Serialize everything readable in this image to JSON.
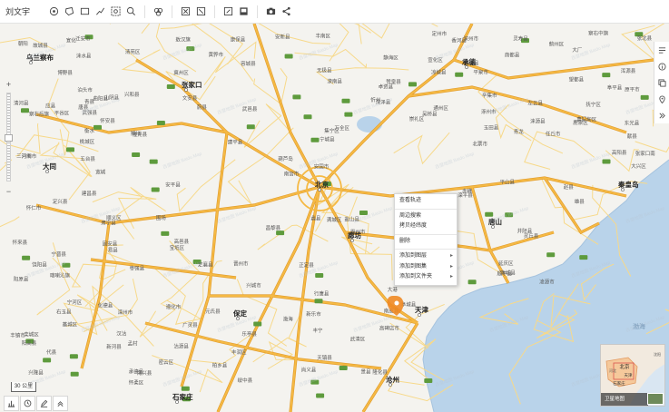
{
  "app": {
    "title": "刘文宇"
  },
  "toolbar": {
    "icons": [
      "locate-icon",
      "polygon-icon",
      "rectangle-icon",
      "polyline-icon",
      "zoom-box-icon",
      "zoom-search-icon",
      "layers-icon",
      "frame-icon",
      "frame-expand-icon",
      "fullscreen-icon",
      "display-icon",
      "camera-icon",
      "share-icon"
    ]
  },
  "map": {
    "cities": [
      {
        "name": "北京"
      },
      {
        "name": "廊坊"
      },
      {
        "name": "保定"
      },
      {
        "name": "天津"
      },
      {
        "name": "张家口"
      },
      {
        "name": "大同"
      },
      {
        "name": "承德"
      },
      {
        "name": "秦皇岛"
      },
      {
        "name": "唐山"
      },
      {
        "name": "沧州"
      },
      {
        "name": "乌兰察布"
      },
      {
        "name": "石家庄"
      }
    ],
    "labels": [
      "化德县",
      "康保县",
      "沽源县",
      "丰宁",
      "隆化县",
      "围场",
      "张北县",
      "尚义县",
      "宣化区",
      "怀来县",
      "延庆区",
      "怀柔区",
      "密云区",
      "平谷区",
      "顺义区",
      "三河市",
      "香河县",
      "大厂",
      "通州区",
      "大兴区",
      "武清区",
      "宝坻区",
      "蓟州区",
      "兴隆县",
      "遵化市",
      "迁安市",
      "滦州市",
      "丰润区",
      "玉田县",
      "宁河区",
      "涿州市",
      "固安县",
      "霸州市",
      "雄县",
      "容城县",
      "安新县",
      "高碑店市",
      "定兴县",
      "易县",
      "涞水县",
      "涞源县",
      "阜平县",
      "蔚县",
      "阳原县",
      "广灵县",
      "灵丘县",
      "浑源县",
      "天镇县",
      "阳高县",
      "怀安县",
      "万全区",
      "崇礼区",
      "赤城县",
      "平泉市",
      "宽城",
      "青龙",
      "抚宁区",
      "昌黎县",
      "乐亭县",
      "滦南县",
      "曹妃甸区",
      "丰南区",
      "汉沽",
      "大港",
      "静海区",
      "文安县",
      "任丘市",
      "河间市",
      "肃宁县",
      "献县",
      "泊头市",
      "青县",
      "黄骅市",
      "孟村",
      "盐山县",
      "海兴县",
      "南皮县",
      "东光县",
      "吴桥县",
      "高阳县",
      "蠡县",
      "博野县",
      "清苑区",
      "望都县",
      "唐县",
      "顺平县",
      "满城区",
      "曲阳县",
      "定州市",
      "安国市",
      "深泽县",
      "无极县",
      "新乐市",
      "行唐县",
      "灵寿县",
      "平山县",
      "井陉县",
      "鹿泉区",
      "正定县",
      "藁城区",
      "晋州市",
      "辛集市",
      "深州市",
      "饶阳县",
      "武强县",
      "衡水",
      "阜城县",
      "景县",
      "枣强县",
      "冀州区",
      "桃城区",
      "宁晋县",
      "赵县",
      "栾城区",
      "元氏县",
      "赞皇县",
      "高邑县",
      "柏乡县",
      "隆尧县",
      "新河县",
      "南宫市",
      "清河县",
      "故城县",
      "武邑县",
      "安平县",
      "定襄县",
      "五台县",
      "繁峙县",
      "代县",
      "原平市",
      "忻州",
      "应县",
      "山阴县",
      "朔州",
      "怀仁市",
      "左云县",
      "右玉县",
      "凉城县",
      "丰镇市",
      "兴和县",
      "商都县",
      "察右后旗",
      "察右中旗",
      "卓资县",
      "集宁区",
      "承德县",
      "滦平县",
      "北票市",
      "建平县",
      "宁城县",
      "喀喇沁旗",
      "赤峰",
      "敖汉旗",
      "凌源市",
      "绥中县",
      "兴城市",
      "葫芦岛",
      "建昌县",
      "朝阳",
      "渤海",
      "宣化",
      "张家口南"
    ],
    "sea_label": "渤海",
    "watermark": "百度地图 Baidu Map"
  },
  "zoom": {
    "plus": "+",
    "minus": "−"
  },
  "right_panel": {
    "icons": [
      "list-icon",
      "info-icon",
      "copy-layers-icon",
      "pin-icon",
      "collapse-icon"
    ]
  },
  "context_menu": {
    "items": [
      {
        "label": "查看轨迹",
        "arrow": false
      },
      {
        "label": "周边搜索",
        "arrow": false
      },
      {
        "label": "拷贝经纬度",
        "arrow": false
      },
      {
        "label": "删除",
        "arrow": false
      },
      {
        "label": "添加到图层",
        "arrow": true
      },
      {
        "label": "添加到图集",
        "arrow": true
      },
      {
        "label": "添加到文件夹",
        "arrow": true
      }
    ]
  },
  "scale": {
    "label": "30 公里"
  },
  "bottom_bar": {
    "icons": [
      "chart-icon",
      "history-icon",
      "edit-icon",
      "collapse-up-icon"
    ]
  },
  "minimap": {
    "caption": "卫星地图",
    "labels": [
      "北京",
      "天津",
      "石家庄",
      "河北",
      "沈阳"
    ]
  },
  "colors": {
    "highway": "#f5b944",
    "highway_border": "#e09a2a",
    "road": "#f7d98a",
    "sea": "#b9d3ea",
    "land": "#f4f3ef",
    "marker": "#f08a24",
    "badge": "#5e9b3d"
  }
}
